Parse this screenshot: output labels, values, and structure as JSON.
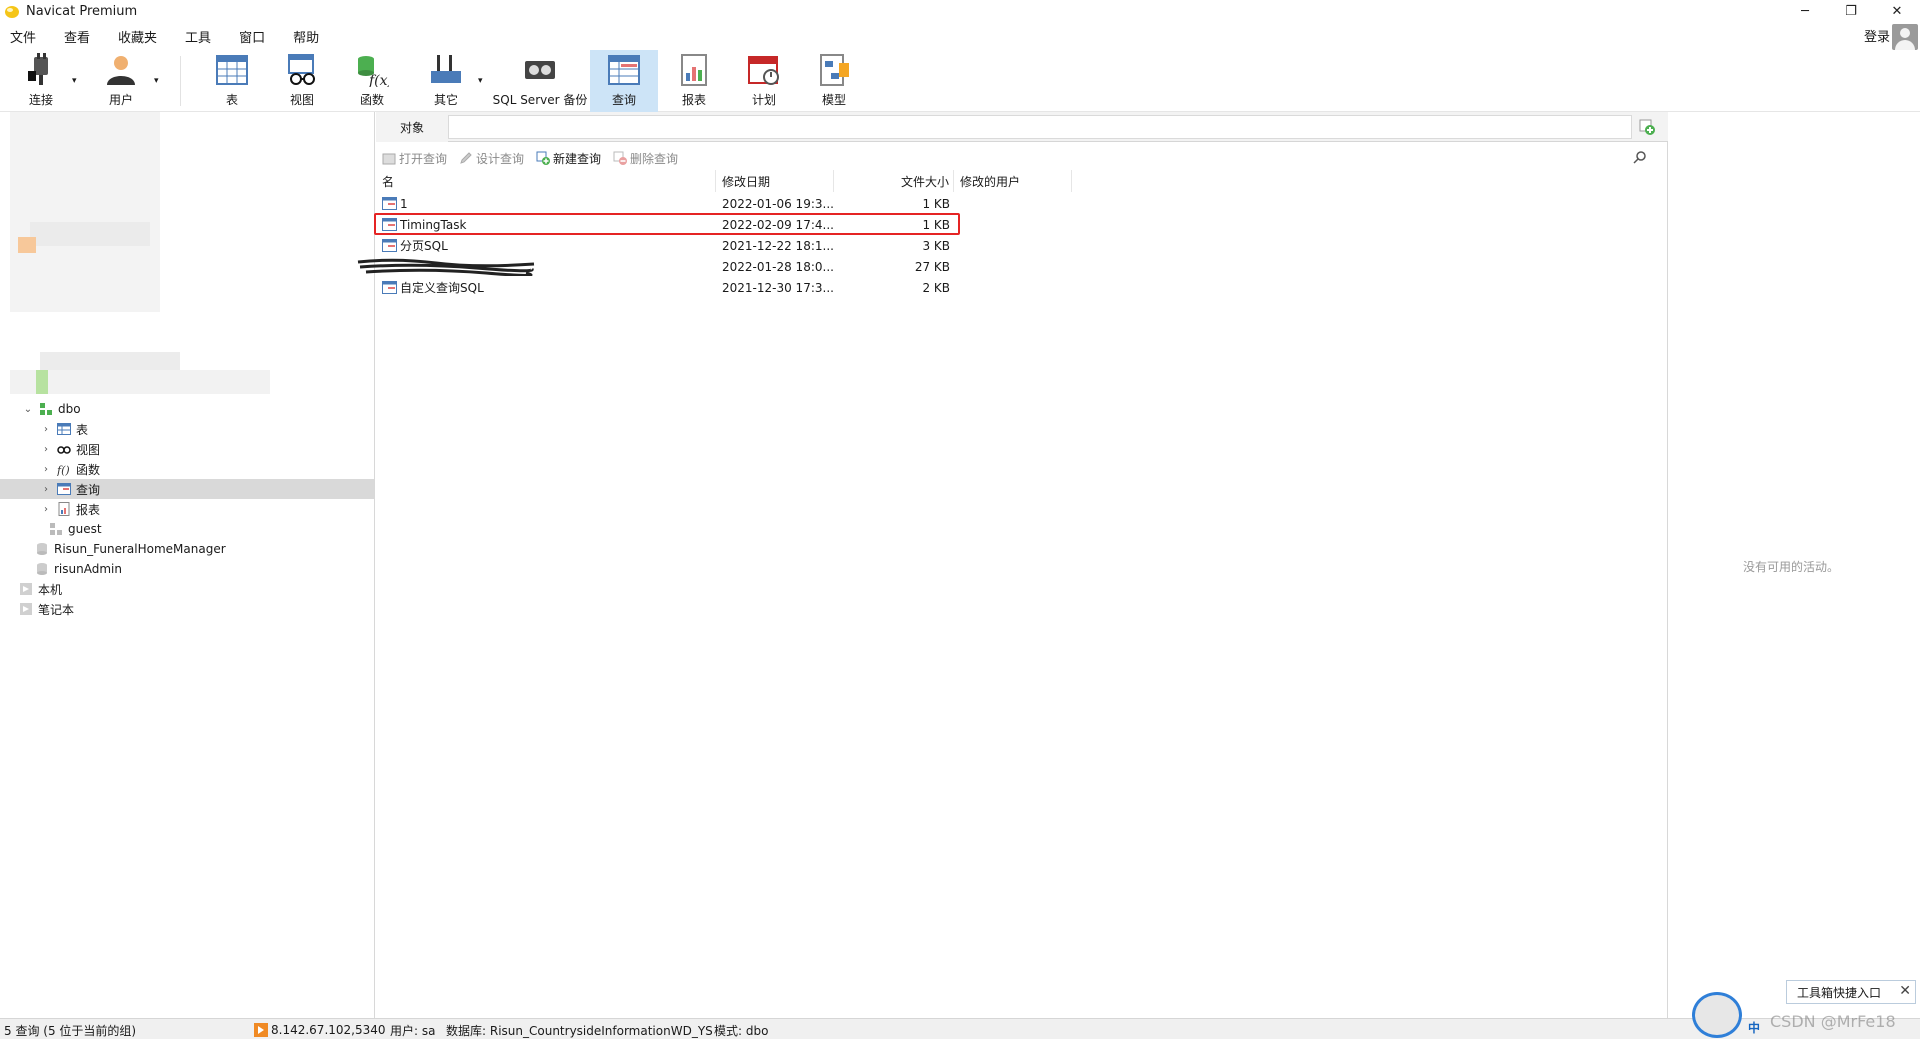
{
  "window": {
    "title": "Navicat Premium",
    "controls": [
      "─",
      "❐",
      "✕"
    ]
  },
  "menu": [
    "文件",
    "查看",
    "收藏夹",
    "工具",
    "窗口",
    "帮助"
  ],
  "account": {
    "login": "登录"
  },
  "toolbar": {
    "connect": "连接",
    "user": "用户",
    "table": "表",
    "view": "视图",
    "function": "函数",
    "other": "其它",
    "backup": "SQL Server 备份",
    "query": "查询",
    "report": "报表",
    "schedule": "计划",
    "model": "模型"
  },
  "sidebar": {
    "schema": "dbo",
    "items": [
      "表",
      "视图",
      "函数",
      "查询",
      "报表"
    ],
    "guest": "guest",
    "databases": [
      "Risun_FuneralHomeManager",
      "risunAdmin"
    ],
    "groups": [
      "本机",
      "笔记本"
    ]
  },
  "object_tab": {
    "label": "对象"
  },
  "actions": {
    "open": "打开查询",
    "design": "设计查询",
    "new": "新建查询",
    "delete": "删除查询"
  },
  "grid": {
    "headers": {
      "name": "名",
      "modified": "修改日期",
      "size": "文件大小",
      "user": "修改的用户"
    },
    "rows": [
      {
        "name": "1",
        "modified": "2022-01-06 19:3...",
        "size": "1 KB"
      },
      {
        "name": "TimingTask",
        "modified": "2022-02-09 17:4...",
        "size": "1 KB"
      },
      {
        "name": "分页SQL",
        "modified": "2021-12-22 18:1...",
        "size": "3 KB"
      },
      {
        "name": "",
        "modified": "2022-01-28 18:0...",
        "size": "27 KB"
      },
      {
        "name": "自定义查询SQL",
        "modified": "2021-12-30 17:3...",
        "size": "2 KB"
      }
    ]
  },
  "right_panel": {
    "empty": "没有可用的活动。"
  },
  "status": {
    "count": "5 查询 (5 位于当前的组)",
    "connection": "8.142.67.102,5340",
    "user": "用户: sa",
    "database": "数据库: Risun_CountrysideInformationWD_YS",
    "schema": "模式: dbo"
  },
  "overlay": {
    "toolbox": "工具箱快捷入口",
    "close": "✕",
    "ime": "中",
    "watermark": "CSDN @MrFe18"
  },
  "colors": {
    "selected_tool": "#cde4f7",
    "highlight": "#e52424",
    "selected_tree": "#d9d9d9"
  }
}
